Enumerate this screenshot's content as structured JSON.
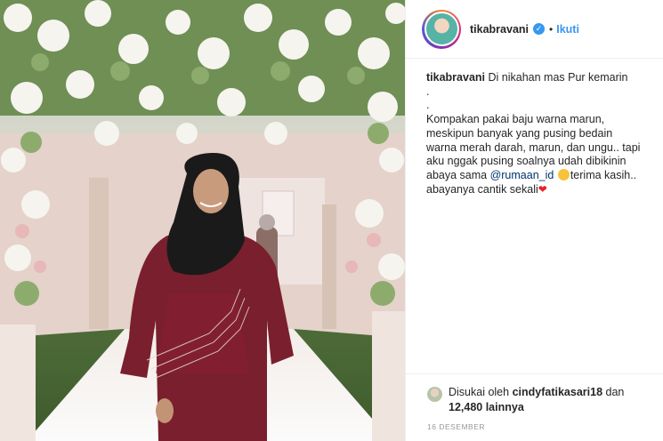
{
  "post": {
    "photo_description": "",
    "author": {
      "username": "tikabravani",
      "verified_icon": "verified-badge-icon",
      "separator": "•",
      "follow_label": "Ikuti"
    },
    "caption": {
      "username": "tikabravani",
      "line1": "Di nikahan mas Pur kemarin",
      "dot1": ".",
      "dot2": ".",
      "line2": "Kompakan pakai baju warna marun,",
      "line3": "meskipun banyak yang pusing bedain",
      "line4": "warna merah darah, marun, dan ungu.. tapi",
      "line5a": "aku nggak pusing soalnya udah dibikinin",
      "line6a": "abaya sama ",
      "mention": "@rumaan_id",
      "line6b": "terima kasih..",
      "line7": "abayanya cantik sekali",
      "heart": "❤"
    },
    "likes": {
      "prefix": "Disukai oleh ",
      "user": "cindyfatikasari18",
      "conj": " dan",
      "count_text": "12,480 lainnya"
    },
    "date": "16 DESEMBER"
  },
  "colors": {
    "accent": "#3897f0",
    "mention": "#003569",
    "dress": "#7a1f2e",
    "hijab": "#1a1a1a"
  }
}
